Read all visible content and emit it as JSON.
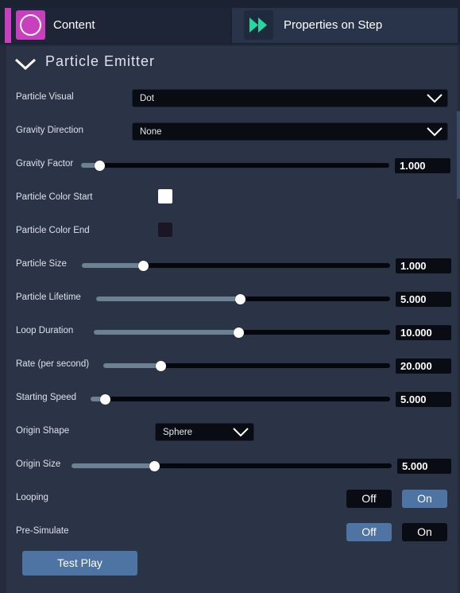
{
  "tabs": {
    "content": {
      "label": "Content",
      "icon": "circle-icon",
      "accent": "#c83fc0"
    },
    "properties": {
      "label": "Properties on Step",
      "icon": "fast-forward-icon",
      "accent": "#27d7a0"
    }
  },
  "section": {
    "title": "Particle Emitter",
    "expanded": true
  },
  "fields": {
    "particle_visual": {
      "label": "Particle Visual",
      "value": "Dot"
    },
    "gravity_direction": {
      "label": "Gravity Direction",
      "value": "None"
    },
    "gravity_factor": {
      "label": "Gravity Factor",
      "value": "1.000",
      "fraction": 0.06
    },
    "particle_color_start": {
      "label": "Particle Color Start",
      "color": "#ffffff"
    },
    "particle_color_end": {
      "label": "Particle Color End",
      "color": "#1b1626"
    },
    "particle_size": {
      "label": "Particle Size",
      "value": "1.000",
      "fraction": 0.2
    },
    "particle_lifetime": {
      "label": "Particle Lifetime",
      "value": "5.000",
      "fraction": 0.49
    },
    "loop_duration": {
      "label": "Loop Duration",
      "value": "10.000",
      "fraction": 0.49
    },
    "rate": {
      "label": "Rate (per second)",
      "value": "20.000",
      "fraction": 0.2
    },
    "starting_speed": {
      "label": "Starting Speed",
      "value": "5.000",
      "fraction": 0.05
    },
    "origin_shape": {
      "label": "Origin Shape",
      "value": "Sphere"
    },
    "origin_size": {
      "label": "Origin Size",
      "value": "5.000",
      "fraction": 0.26
    },
    "looping": {
      "label": "Looping",
      "off": "Off",
      "on": "On",
      "selected": "on"
    },
    "pre_simulate": {
      "label": "Pre-Simulate",
      "off": "Off",
      "on": "On",
      "selected": "off"
    }
  },
  "buttons": {
    "test_play": "Test Play"
  }
}
